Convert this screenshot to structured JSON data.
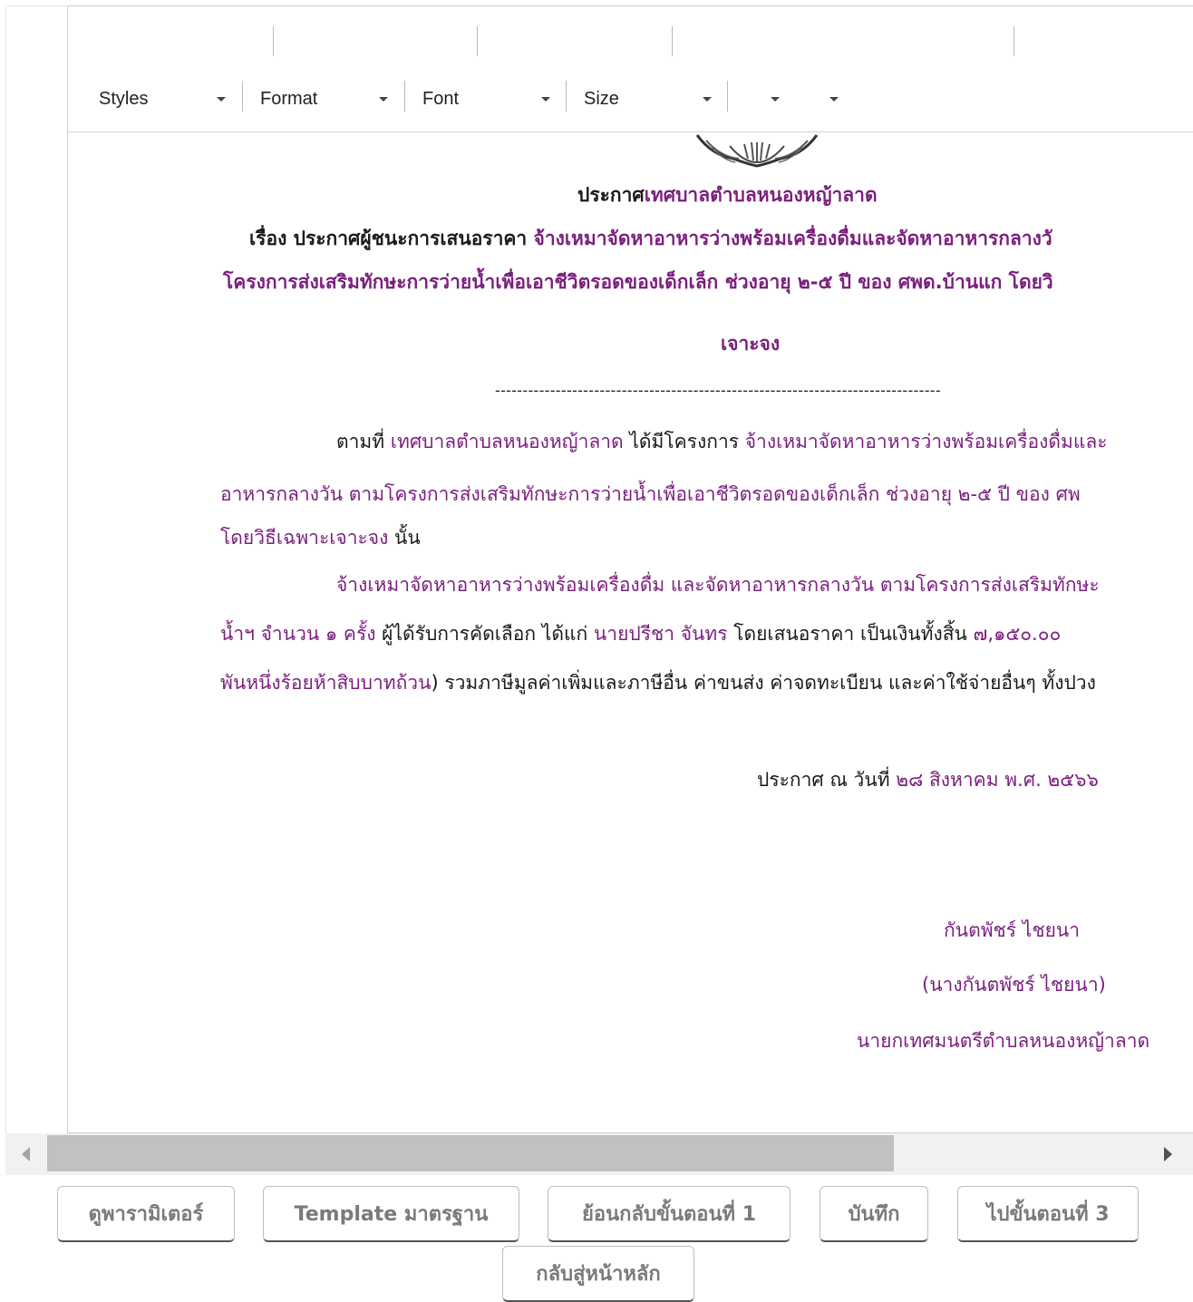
{
  "toolbar": {
    "styles": "Styles",
    "format": "Format",
    "font": "Font",
    "size": "Size"
  },
  "document": {
    "title_prefix": "ประกาศ",
    "title_org": "เทศบาลตำบลหนองหญ้าลาด",
    "subject_prefix": "เรื่อง ประกาศผู้ชนะการเสนอราคา ",
    "subject_1": "จ้างเหมาจัดหาอาหารว่างพร้อมเครื่องดื่มและจัดหาอาหารกลางวั",
    "subject_2": "โครงการส่งเสริมทักษะการว่ายน้ำเพื่อเอาชีวิตรอดของเด็กเล็ก ช่วงอายุ ๒-๕ ปี ของ ศพด.บ้านแก โดยวิ",
    "subject_3": "เจาะจง",
    "divider": "---------------------------------------------------------------------------------",
    "p1_lead": "ตามที่ ",
    "p1_org": "เทศบาลตำบลหนองหญ้าลาด",
    "p1_mid": " ได้มีโครงการ ",
    "p1_project": "จ้างเหมาจัดหาอาหารว่างพร้อมเครื่องดื่มและ",
    "p1_line2": "อาหารกลางวัน ตามโครงการส่งเสริมทักษะการว่ายน้ำเพื่อเอาชีวิตรอดของเด็กเล็ก ช่วงอายุ ๒-๕ ปี ของ ศพ",
    "p1_line3_purple": "โดยวิธีเฉพาะเจาะจง",
    "p1_line3_end": "  นั้น",
    "p2_line1": "จ้างเหมาจัดหาอาหารว่างพร้อมเครื่องดื่ม และจัดหาอาหารกลางวัน ตามโครงการส่งเสริมทักษะ",
    "p2_l2_a": "น้ำฯ จำนวน ๑ ครั้ง",
    "p2_l2_b": " ผู้ได้รับการคัดเลือก ได้แก่ ",
    "p2_l2_c": "นายปรีชา จันทร",
    "p2_l2_d": " โดยเสนอราคา เป็นเงินทั้งสิ้น ",
    "p2_l2_e": "๗,๑๕๐.๐๐",
    "p2_l3_a": "พันหนึ่งร้อยห้าสิบบาทถ้วน",
    "p2_l3_b": ") รวมภาษีมูลค่าเพิ่มและภาษีอื่น ค่าขนส่ง ค่าจดทะเบียน และค่าใช้จ่ายอื่นๆ ทั้งปวง",
    "date_label": "ประกาศ ณ วันที่  ",
    "date_value": "๒๘ สิงหาคม พ.ศ. ๒๕๖๖",
    "sig_name": "กันตพัชร์ ไชยนา",
    "sig_fullname": "(นางกันตพัชร์ ไชยนา)",
    "sig_position": "นายกเทศมนตรีตำบลหนองหญ้าลาด"
  },
  "buttons": {
    "view_params": "ดูพารามิเตอร์",
    "template": "Template มาตรฐาน",
    "back_step1": "ย้อนกลับขั้นตอนที่ 1",
    "save": "บันทึก",
    "go_step3": "ไปขั้นตอนที่ 3",
    "home": "กลับสู่หน้าหลัก"
  },
  "colors": {
    "purple_text": "#7a1f7d",
    "scroll_thumb": "#c1c1c1"
  }
}
